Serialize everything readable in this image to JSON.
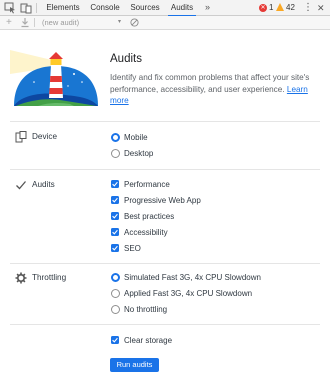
{
  "devtools": {
    "tabs": [
      "Elements",
      "Console",
      "Sources",
      "Audits"
    ],
    "active_tab": "Audits",
    "more_tabs": "»",
    "error_count": "1",
    "warning_count": "42",
    "menu": "⋮",
    "close": "✕"
  },
  "toolbar": {
    "new_audit": "+",
    "select_value": "(new audit)",
    "select_caret": "▾"
  },
  "header": {
    "title": "Audits",
    "description": "Identify and fix common problems that affect your site's performance, accessibility, and user experience.",
    "learn_more": "Learn more"
  },
  "sections": {
    "device": {
      "label": "Device",
      "options": [
        {
          "label": "Mobile",
          "selected": true
        },
        {
          "label": "Desktop",
          "selected": false
        }
      ]
    },
    "audits": {
      "label": "Audits",
      "options": [
        {
          "label": "Performance",
          "checked": true
        },
        {
          "label": "Progressive Web App",
          "checked": true
        },
        {
          "label": "Best practices",
          "checked": true
        },
        {
          "label": "Accessibility",
          "checked": true
        },
        {
          "label": "SEO",
          "checked": true
        }
      ]
    },
    "throttling": {
      "label": "Throttling",
      "options": [
        {
          "label": "Simulated Fast 3G, 4x CPU Slowdown",
          "selected": true
        },
        {
          "label": "Applied Fast 3G, 4x CPU Slowdown",
          "selected": false
        },
        {
          "label": "No throttling",
          "selected": false
        }
      ]
    },
    "storage": {
      "label": "Clear storage",
      "checked": true
    }
  },
  "run_button": "Run audits",
  "colors": {
    "accent": "#1a73e8",
    "error": "#e53935",
    "warning": "#f9a825"
  }
}
